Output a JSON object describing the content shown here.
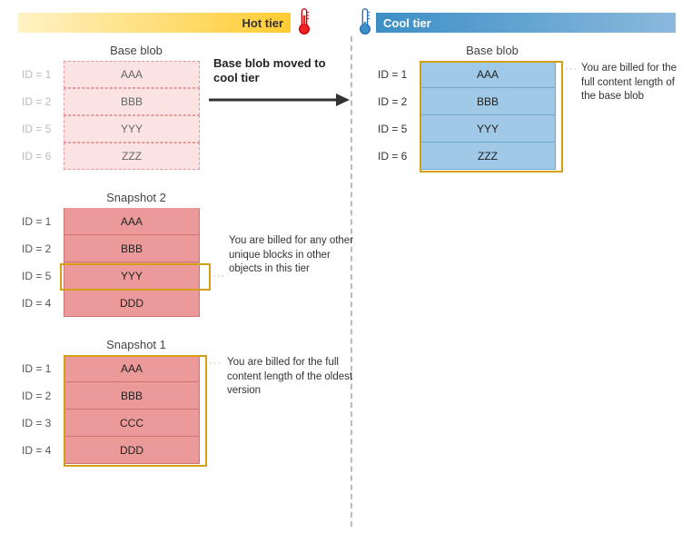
{
  "tiers": {
    "hot": {
      "label": "Hot tier"
    },
    "cool": {
      "label": "Cool tier"
    }
  },
  "arrow_label": "Base blob moved to cool tier",
  "groups": {
    "base_hot": {
      "title": "Base blob",
      "rows": [
        {
          "id": "ID = 1",
          "val": "AAA"
        },
        {
          "id": "ID = 2",
          "val": "BBB"
        },
        {
          "id": "ID = 5",
          "val": "YYY"
        },
        {
          "id": "ID = 6",
          "val": "ZZZ"
        }
      ]
    },
    "snap2": {
      "title": "Snapshot 2",
      "rows": [
        {
          "id": "ID = 1",
          "val": "AAA"
        },
        {
          "id": "ID = 2",
          "val": "BBB"
        },
        {
          "id": "ID = 5",
          "val": "YYY"
        },
        {
          "id": "ID = 4",
          "val": "DDD"
        }
      ]
    },
    "snap1": {
      "title": "Snapshot 1",
      "rows": [
        {
          "id": "ID = 1",
          "val": "AAA"
        },
        {
          "id": "ID = 2",
          "val": "BBB"
        },
        {
          "id": "ID = 3",
          "val": "CCC"
        },
        {
          "id": "ID = 4",
          "val": "DDD"
        }
      ]
    },
    "base_cool": {
      "title": "Base blob",
      "rows": [
        {
          "id": "ID = 1",
          "val": "AAA"
        },
        {
          "id": "ID = 2",
          "val": "BBB"
        },
        {
          "id": "ID = 5",
          "val": "YYY"
        },
        {
          "id": "ID = 6",
          "val": "ZZZ"
        }
      ]
    }
  },
  "annotations": {
    "cool_full": "You are billed for the full content length of the base blob",
    "unique_blocks": "You are billed for any other unique blocks in other objects in this tier",
    "oldest_full": "You are billed for the full content length of the oldest version"
  }
}
